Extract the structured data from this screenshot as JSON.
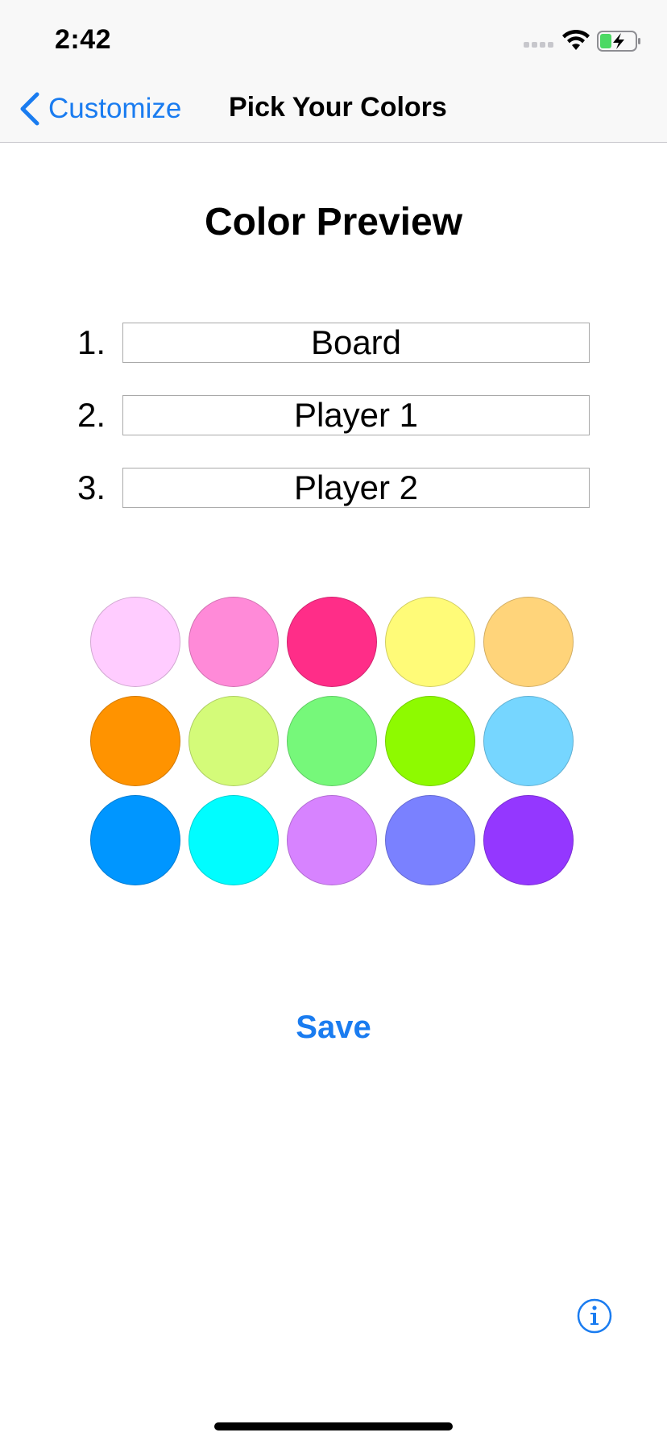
{
  "status_bar": {
    "time": "2:42"
  },
  "nav": {
    "back_label": "Customize",
    "title": "Pick Your Colors"
  },
  "preview": {
    "title": "Color Preview",
    "rows": [
      {
        "number": "1.",
        "label": "Board"
      },
      {
        "number": "2.",
        "label": "Player 1"
      },
      {
        "number": "3.",
        "label": "Player 2"
      }
    ]
  },
  "swatches": [
    [
      "#FFCCFF",
      "#FF8AD8",
      "#FF2D88",
      "#FFFB78",
      "#FFD47A"
    ],
    [
      "#FF9300",
      "#D4FB79",
      "#76F87A",
      "#8EFA00",
      "#76D6FF"
    ],
    [
      "#0096FF",
      "#00FDFF",
      "#D783FF",
      "#7A81FF",
      "#9437FF"
    ]
  ],
  "save_label": "Save",
  "colors": {
    "accent": "#1A7CF0",
    "bar_background": "#F8F8F8"
  },
  "icons": {
    "back": "chevron-left-icon",
    "info": "info-icon",
    "wifi": "wifi-icon",
    "battery": "battery-charging-icon",
    "signal": "cellular-signal-icon"
  }
}
